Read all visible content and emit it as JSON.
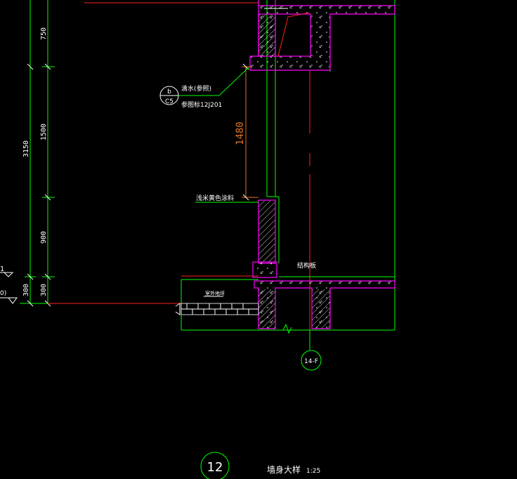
{
  "dimensions": {
    "total": "3150",
    "d750": "750",
    "d1500": "1500",
    "d900": "900",
    "d300a": "300",
    "d300b": "300",
    "window_height": "1480"
  },
  "callout": {
    "letter": "b",
    "ref": "C5",
    "line1": "滴水(参照)",
    "line2": "参图标12J201"
  },
  "labels": {
    "coating": "浅米黄色涂料",
    "structure": "结构板",
    "outdoor": "室外地坪",
    "left_mark_1": "1",
    "left_mark_2": "0)"
  },
  "axis": {
    "label": "14-F"
  },
  "title": {
    "number": "12",
    "name": "墙身大样",
    "scale": "1:25"
  },
  "colors": {
    "background": "#000000",
    "dimension": "#00ff00",
    "section": "#ff00ff",
    "axis_line": "#ff2020",
    "dim_1480": "#e07020",
    "text": "#ffffff"
  }
}
